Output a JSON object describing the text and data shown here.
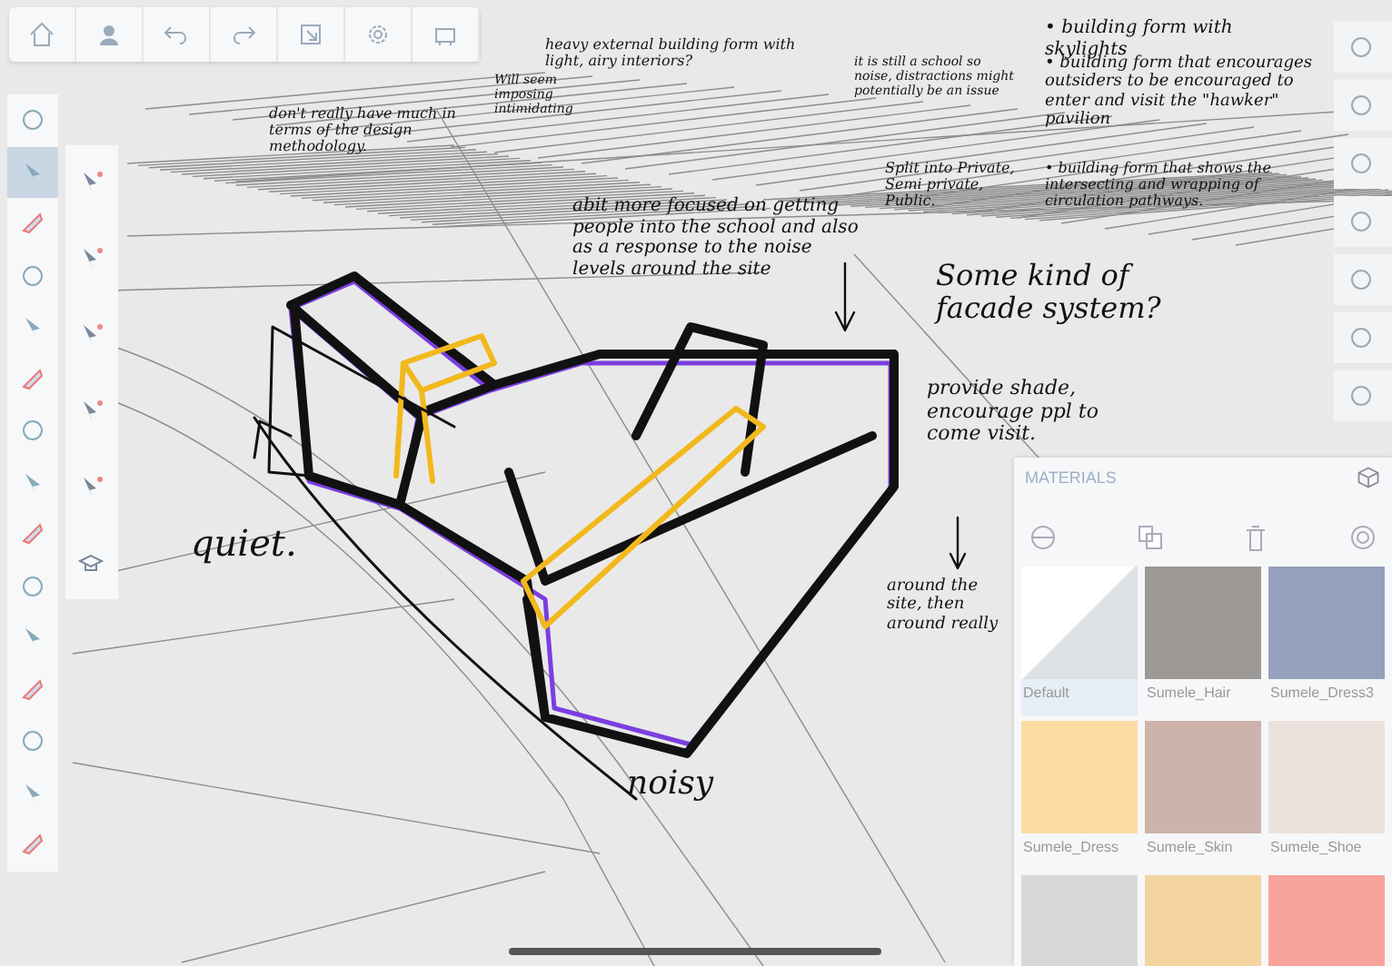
{
  "left_toolbar": [
    {
      "selected": false
    },
    {
      "selected": true
    },
    {
      "selected": false
    },
    {
      "selected": false
    },
    {
      "selected": false
    },
    {
      "selected": false
    },
    {
      "selected": false
    },
    {
      "selected": false
    },
    {
      "selected": false
    },
    {
      "selected": false
    },
    {
      "selected": false
    },
    {
      "selected": false
    },
    {
      "selected": false
    },
    {
      "selected": false
    },
    {
      "selected": false
    }
  ],
  "sketch_notes": [
    {
      "text": "don't really have much in terms of the design methodology."
    },
    {
      "text": "Will seem imposing intimidating"
    },
    {
      "text": "heavy external building form with light, airy interiors?"
    },
    {
      "text": "it is still a school so noise, distractions might potentially be an issue"
    },
    {
      "text": "Split into Private, Semi private, Public."
    },
    {
      "text": "• building form with skylights"
    },
    {
      "text": "• building form that encourages outsiders to be encouraged to enter and visit the \"hawker\" pavilion"
    },
    {
      "text": "• building form that shows the intersecting and wrapping of circulation pathways."
    },
    {
      "text": "abit more focused on getting people into the school and also as a response to the noise levels around the site"
    },
    {
      "text": "Some kind of facade system?"
    },
    {
      "text": "provide shade, encourage ppl to come visit."
    },
    {
      "text": "around the site, then around really"
    },
    {
      "text": "quiet."
    },
    {
      "text": "noisy"
    }
  ],
  "materials": {
    "title": "MATERIALS",
    "swatches": [
      {
        "name": "Default",
        "color": "#dde1e5",
        "selected": true
      },
      {
        "name": "Sumele_Hair",
        "color": "#9b9896",
        "selected": false
      },
      {
        "name": "Sumele_Dress3",
        "color": "#95a0bd",
        "selected": false
      },
      {
        "name": "Sumele_Dress",
        "color": "#fbdca3",
        "selected": false
      },
      {
        "name": "Sumele_Skin",
        "color": "#cdb3ac",
        "selected": false
      },
      {
        "name": "Sumele_Shoe",
        "color": "#ebe1dc",
        "selected": false
      },
      {
        "color": "#d8d8d8"
      },
      {
        "color": "#f4d5a0"
      },
      {
        "color": "#f8a49b"
      }
    ]
  }
}
